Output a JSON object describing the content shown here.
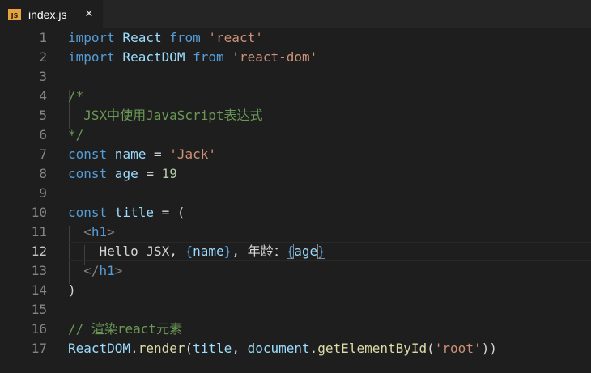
{
  "tab": {
    "icon_label": "JS",
    "filename": "index.js",
    "close_glyph": "✕"
  },
  "lines": [
    {
      "n": "1",
      "tokens": [
        {
          "t": "import",
          "c": "kw"
        },
        {
          "t": " React ",
          "c": "var"
        },
        {
          "t": "from",
          "c": "kw"
        },
        {
          "t": " ",
          "c": "punc"
        },
        {
          "t": "'react'",
          "c": "str"
        }
      ]
    },
    {
      "n": "2",
      "tokens": [
        {
          "t": "import",
          "c": "kw"
        },
        {
          "t": " ReactDOM ",
          "c": "var"
        },
        {
          "t": "from",
          "c": "kw"
        },
        {
          "t": " ",
          "c": "punc"
        },
        {
          "t": "'react-dom'",
          "c": "str"
        }
      ]
    },
    {
      "n": "3",
      "tokens": []
    },
    {
      "n": "4",
      "tokens": [
        {
          "t": "/*",
          "c": "cmt"
        }
      ]
    },
    {
      "n": "5",
      "tokens": [
        {
          "t": "  JSX中使用JavaScript表达式",
          "c": "cmt"
        }
      ]
    },
    {
      "n": "6",
      "tokens": [
        {
          "t": "*/",
          "c": "cmt"
        }
      ]
    },
    {
      "n": "7",
      "tokens": [
        {
          "t": "const",
          "c": "kw"
        },
        {
          "t": " name",
          "c": "var"
        },
        {
          "t": " = ",
          "c": "punc"
        },
        {
          "t": "'Jack'",
          "c": "str"
        }
      ]
    },
    {
      "n": "8",
      "tokens": [
        {
          "t": "const",
          "c": "kw"
        },
        {
          "t": " age",
          "c": "var"
        },
        {
          "t": " = ",
          "c": "punc"
        },
        {
          "t": "19",
          "c": "num"
        }
      ]
    },
    {
      "n": "9",
      "tokens": []
    },
    {
      "n": "10",
      "tokens": [
        {
          "t": "const",
          "c": "kw"
        },
        {
          "t": " title",
          "c": "var"
        },
        {
          "t": " = (",
          "c": "punc"
        }
      ]
    },
    {
      "n": "11",
      "tokens": [
        {
          "t": "  <",
          "c": "tag-br"
        },
        {
          "t": "h1",
          "c": "tag"
        },
        {
          "t": ">",
          "c": "tag-br"
        }
      ]
    },
    {
      "n": "12",
      "tokens": [
        {
          "t": "    Hello JSX, ",
          "c": "punc"
        },
        {
          "t": "{",
          "c": "brace"
        },
        {
          "t": "name",
          "c": "var"
        },
        {
          "t": "}",
          "c": "brace"
        },
        {
          "t": ", 年龄：",
          "c": "punc"
        },
        {
          "t": "{",
          "c": "brace",
          "m": true
        },
        {
          "t": "age",
          "c": "var"
        },
        {
          "t": "}",
          "c": "brace",
          "m": true
        }
      ]
    },
    {
      "n": "13",
      "tokens": [
        {
          "t": "  </",
          "c": "tag-br"
        },
        {
          "t": "h1",
          "c": "tag"
        },
        {
          "t": ">",
          "c": "tag-br"
        }
      ]
    },
    {
      "n": "14",
      "tokens": [
        {
          "t": ")",
          "c": "punc"
        }
      ]
    },
    {
      "n": "15",
      "tokens": []
    },
    {
      "n": "16",
      "tokens": [
        {
          "t": "// 渲染react元素",
          "c": "cmt"
        }
      ]
    },
    {
      "n": "17",
      "tokens": [
        {
          "t": "ReactDOM",
          "c": "var"
        },
        {
          "t": ".",
          "c": "punc"
        },
        {
          "t": "render",
          "c": "fn"
        },
        {
          "t": "(",
          "c": "punc"
        },
        {
          "t": "title",
          "c": "var"
        },
        {
          "t": ", ",
          "c": "punc"
        },
        {
          "t": "document",
          "c": "var"
        },
        {
          "t": ".",
          "c": "punc"
        },
        {
          "t": "getElementById",
          "c": "fn"
        },
        {
          "t": "(",
          "c": "punc"
        },
        {
          "t": "'root'",
          "c": "str"
        },
        {
          "t": "))",
          "c": "punc"
        }
      ]
    }
  ],
  "current_line": "12"
}
